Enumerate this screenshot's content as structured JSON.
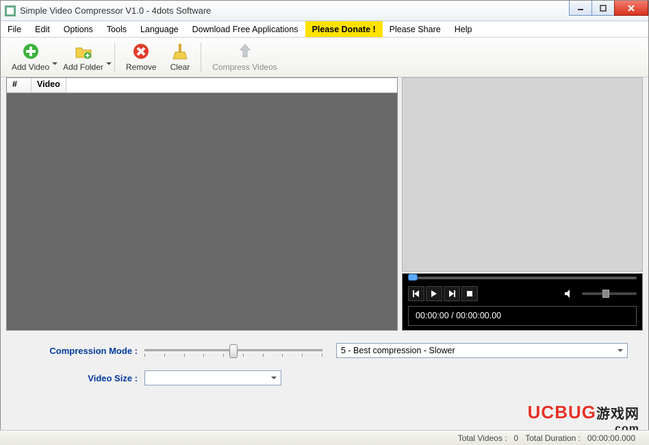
{
  "title": "Simple Video Compressor V1.0 - 4dots Software",
  "menu": [
    "File",
    "Edit",
    "Options",
    "Tools",
    "Language",
    "Download Free Applications",
    "Please Donate !",
    "Please Share",
    "Help"
  ],
  "toolbar": {
    "add_video": "Add Video",
    "add_folder": "Add Folder",
    "remove": "Remove",
    "clear": "Clear",
    "compress": "Compress Videos"
  },
  "list": {
    "col_num": "#",
    "col_video": "Video"
  },
  "player": {
    "timecode": "00:00:00 / 00:00:00.00"
  },
  "settings": {
    "mode_label": "Compression Mode :",
    "mode_value": "5 - Best compression - Slower",
    "size_label": "Video Size :",
    "size_value": ""
  },
  "status": {
    "videos_label": "Total Videos :",
    "videos_value": "0",
    "duration_label": "Total Duration :",
    "duration_value": "00:00:00.000"
  },
  "watermark": {
    "brand": "UCBUG",
    "cjk": "游戏网",
    "com": ".com"
  }
}
